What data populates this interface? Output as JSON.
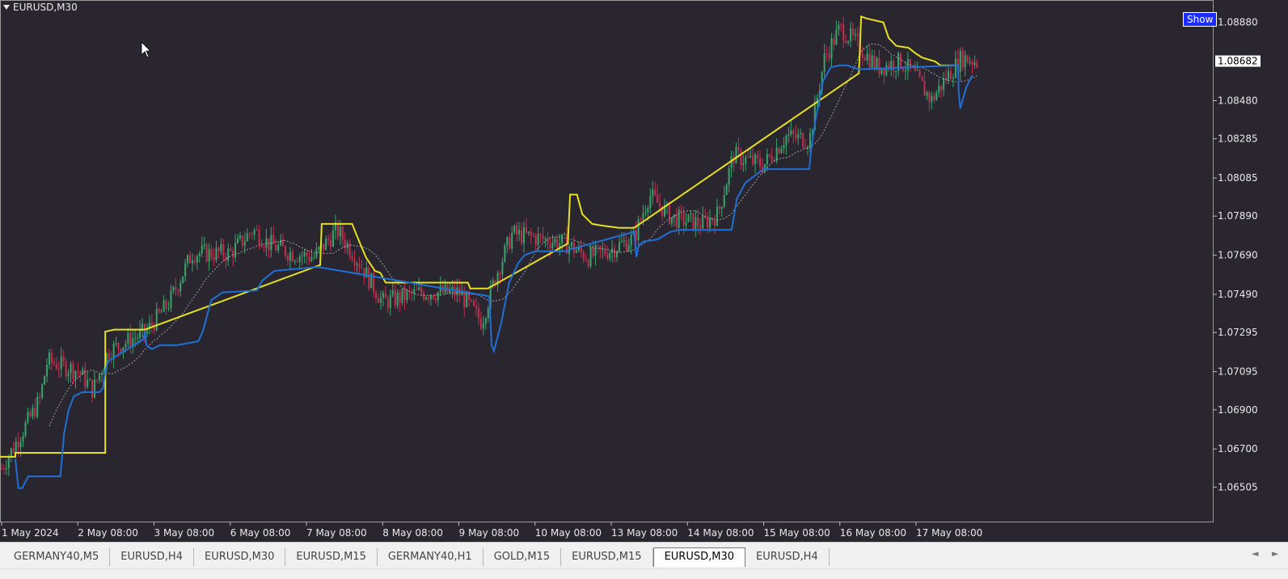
{
  "header": {
    "symbol_title": "EURUSD,M30",
    "show_button": "Show"
  },
  "colors": {
    "background": "#2a2630",
    "up_candle": "#3aa56b",
    "down_candle": "#c2304f",
    "upper_line": "#e6e01e",
    "lower_line": "#1f6fd6",
    "moving_average": "#bdbdbd",
    "axis_text": "#e8e8e8",
    "price_label_bg": "#ffffff"
  },
  "tabs": [
    "GERMANY40,M5",
    "EURUSD,H4",
    "EURUSD,M30",
    "EURUSD,M15",
    "GERMANY40,H1",
    "GOLD,M15",
    "EURUSD,M15",
    "EURUSD,M30",
    "EURUSD,H4"
  ],
  "active_tab_index": 7,
  "icons": {
    "scroll_left": "◄",
    "scroll_right": "►",
    "collapse": "▼"
  },
  "chart_data": {
    "type": "candlestick",
    "title": "EURUSD,M30",
    "current_price": "1.08682",
    "x_ticks": [
      {
        "label": "1 May 2024",
        "x": 0
      },
      {
        "label": "2 May 08:00",
        "x": 1
      },
      {
        "label": "3 May 08:00",
        "x": 2
      },
      {
        "label": "6 May 08:00",
        "x": 3
      },
      {
        "label": "7 May 08:00",
        "x": 4
      },
      {
        "label": "8 May 08:00",
        "x": 5
      },
      {
        "label": "9 May 08:00",
        "x": 6
      },
      {
        "label": "10 May 08:00",
        "x": 7
      },
      {
        "label": "13 May 08:00",
        "x": 8
      },
      {
        "label": "14 May 08:00",
        "x": 9
      },
      {
        "label": "15 May 08:00",
        "x": 10
      },
      {
        "label": "16 May 08:00",
        "x": 11
      },
      {
        "label": "17 May 08:00",
        "x": 12
      }
    ],
    "y_ticks": [
      "1.08880",
      "1.08480",
      "1.08285",
      "1.08085",
      "1.07890",
      "1.07690",
      "1.07490",
      "1.07295",
      "1.07095",
      "1.06900",
      "1.06700",
      "1.06505"
    ],
    "ylim": [
      1.0645,
      1.0902
    ],
    "x_range": [
      0,
      16
    ],
    "series": [
      {
        "name": "",
        "role": "upper_band",
        "points": [
          [
            -0.05,
            1.0666
          ],
          [
            0.18,
            1.0666
          ],
          [
            0.18,
            1.0668
          ],
          [
            1.22,
            1.0668
          ],
          [
            1.36,
            1.0668
          ],
          [
            1.36,
            1.073
          ],
          [
            1.48,
            1.0731
          ],
          [
            1.88,
            1.0731
          ],
          [
            4.18,
            1.0764
          ],
          [
            4.2,
            1.0785
          ],
          [
            4.6,
            1.0785
          ],
          [
            4.65,
            1.078
          ],
          [
            4.78,
            1.0768
          ],
          [
            4.9,
            1.0761
          ],
          [
            4.97,
            1.076
          ],
          [
            5.04,
            1.0755
          ],
          [
            6.12,
            1.0755
          ],
          [
            6.15,
            1.0752
          ],
          [
            6.38,
            1.0752
          ],
          [
            7.43,
            1.0775
          ],
          [
            7.46,
            1.08
          ],
          [
            7.55,
            1.08
          ],
          [
            7.62,
            1.079
          ],
          [
            7.75,
            1.0785
          ],
          [
            7.9,
            1.0784
          ],
          [
            8.1,
            1.0783
          ],
          [
            8.3,
            1.0783
          ],
          [
            11.25,
            1.0862
          ],
          [
            11.28,
            1.0891
          ],
          [
            11.35,
            1.089
          ],
          [
            11.57,
            1.0888
          ],
          [
            11.64,
            1.088
          ],
          [
            11.74,
            1.0876
          ],
          [
            11.9,
            1.0875
          ],
          [
            12.0,
            1.0872
          ],
          [
            12.08,
            1.087
          ],
          [
            12.25,
            1.0868
          ],
          [
            12.32,
            1.0866
          ],
          [
            12.5,
            1.0866
          ],
          [
            12.55,
            1.0866
          ]
        ]
      },
      {
        "name": "",
        "role": "lower_band",
        "points": [
          [
            0.18,
            1.0665
          ],
          [
            0.22,
            1.065
          ],
          [
            0.27,
            1.065
          ],
          [
            0.35,
            1.0656
          ],
          [
            0.77,
            1.0656
          ],
          [
            0.82,
            1.0678
          ],
          [
            0.88,
            1.069
          ],
          [
            0.95,
            1.0697
          ],
          [
            1.06,
            1.0699
          ],
          [
            1.28,
            1.0699
          ],
          [
            1.33,
            1.0701
          ],
          [
            1.36,
            1.071
          ],
          [
            1.4,
            1.0715
          ],
          [
            1.86,
            1.0726
          ],
          [
            1.88,
            1.073
          ],
          [
            1.9,
            1.0723
          ],
          [
            1.97,
            1.0721
          ],
          [
            2.08,
            1.0723
          ],
          [
            2.3,
            1.0723
          ],
          [
            2.58,
            1.0725
          ],
          [
            2.64,
            1.073
          ],
          [
            2.75,
            1.0746
          ],
          [
            2.9,
            1.075
          ],
          [
            3.35,
            1.0751
          ],
          [
            3.42,
            1.0756
          ],
          [
            3.58,
            1.0761
          ],
          [
            4.15,
            1.0763
          ],
          [
            6.4,
            1.0748
          ],
          [
            6.43,
            1.0723
          ],
          [
            6.46,
            1.072
          ],
          [
            6.56,
            1.0735
          ],
          [
            6.66,
            1.0755
          ],
          [
            6.78,
            1.0765
          ],
          [
            6.86,
            1.0769
          ],
          [
            7.0,
            1.0771
          ],
          [
            7.42,
            1.0771
          ],
          [
            7.46,
            1.0772
          ],
          [
            8.3,
            1.0781
          ],
          [
            8.33,
            1.0768
          ],
          [
            8.36,
            1.0774
          ],
          [
            8.42,
            1.0776
          ],
          [
            8.6,
            1.0777
          ],
          [
            8.78,
            1.0781
          ],
          [
            8.9,
            1.0782
          ],
          [
            9.58,
            1.0782
          ],
          [
            9.65,
            1.0798
          ],
          [
            9.76,
            1.0806
          ],
          [
            10.0,
            1.0813
          ],
          [
            10.58,
            1.0813
          ],
          [
            10.6,
            1.0813
          ],
          [
            10.62,
            1.0822
          ],
          [
            10.68,
            1.0838
          ],
          [
            10.78,
            1.0858
          ],
          [
            10.88,
            1.0865
          ],
          [
            11.0,
            1.0866
          ],
          [
            11.1,
            1.0866
          ],
          [
            11.25,
            1.0864
          ],
          [
            12.55,
            1.0866
          ],
          [
            12.56,
            1.0852
          ],
          [
            12.58,
            1.0844
          ],
          [
            12.66,
            1.0855
          ],
          [
            12.74,
            1.0861
          ]
        ]
      }
    ]
  }
}
